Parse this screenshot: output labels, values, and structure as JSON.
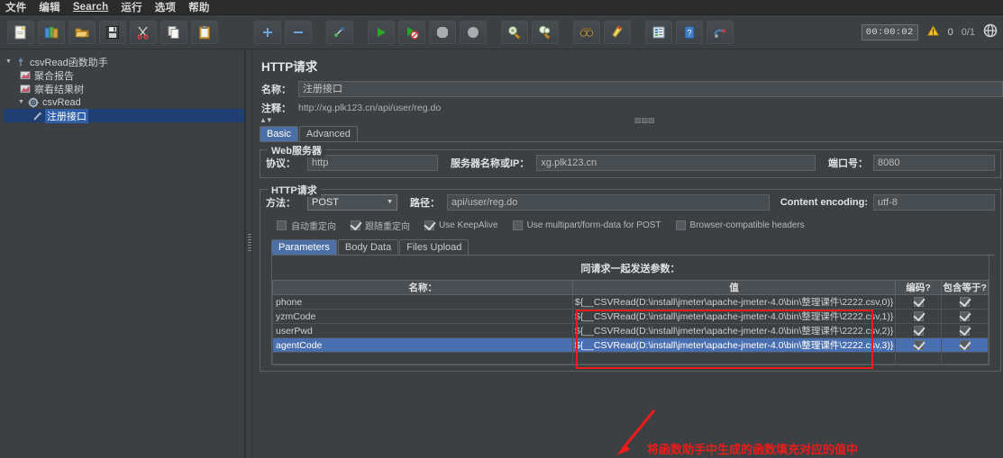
{
  "menu": {
    "items": [
      {
        "label": "文件"
      },
      {
        "label": "编辑"
      },
      {
        "label": "Search",
        "underline_first": true
      },
      {
        "label": "运行"
      },
      {
        "label": "选项"
      },
      {
        "label": "帮助"
      }
    ]
  },
  "toolbar": {
    "left_buttons": [
      {
        "name": "new-icon"
      },
      {
        "name": "templates-icon"
      },
      {
        "name": "open-icon"
      },
      {
        "name": "save-icon"
      },
      {
        "name": "cut-icon"
      },
      {
        "name": "copy-icon"
      },
      {
        "name": "paste-icon"
      }
    ],
    "main_buttons": [
      {
        "name": "expand-all-icon"
      },
      {
        "name": "collapse-all-icon"
      },
      {
        "name": "toggle-icon"
      },
      {
        "name": "start-icon"
      },
      {
        "name": "start-no-pauses-icon"
      },
      {
        "name": "stop-icon"
      },
      {
        "name": "shutdown-icon"
      },
      {
        "name": "clear-icon"
      },
      {
        "name": "clear-all-icon"
      },
      {
        "name": "search-icon"
      },
      {
        "name": "search-reset-icon"
      },
      {
        "name": "function-helper-icon"
      },
      {
        "name": "help-icon"
      },
      {
        "name": "undo-redo-icon"
      }
    ],
    "status": {
      "timer": "00:00:02",
      "warning_count": "0",
      "thread_count": "0/1",
      "warning_icon": "warning-triangle-icon",
      "remote_icon": "globe-icon"
    }
  },
  "tree": {
    "nodes": [
      {
        "label": "csvRead函数助手",
        "icon": "test-plan-icon",
        "depth": 0,
        "expanded": true,
        "selected": false
      },
      {
        "label": "聚合报告",
        "icon": "report-icon",
        "depth": 1,
        "expanded": null,
        "selected": false
      },
      {
        "label": "察看结果树",
        "icon": "report-icon",
        "depth": 1,
        "expanded": null,
        "selected": false
      },
      {
        "label": "csvRead",
        "icon": "thread-group-icon",
        "depth": 1,
        "expanded": true,
        "selected": false
      },
      {
        "label": "注册接口",
        "icon": "http-sampler-icon",
        "depth": 2,
        "expanded": null,
        "selected": true
      }
    ]
  },
  "panel": {
    "title": "HTTP请求",
    "name_label": "名称：",
    "name_value": "注册接口",
    "comment_label": "注释：",
    "comment_value": "http://xg.plk123.cn/api/user/reg.do",
    "tabs": [
      {
        "label": "Basic",
        "active": true
      },
      {
        "label": "Advanced",
        "active": false
      }
    ],
    "webserver": {
      "group_title": "Web服务器",
      "protocol_label": "协议：",
      "protocol_value": "http",
      "server_label": "服务器名称或IP：",
      "server_value": "xg.plk123.cn",
      "port_label": "端口号：",
      "port_value": "8080"
    },
    "httprequest": {
      "group_title": "HTTP请求",
      "method_label": "方法：",
      "method_value": "POST",
      "path_label": "路径：",
      "path_value": "api/user/reg.do",
      "encoding_label": "Content encoding:",
      "encoding_value": "utf-8",
      "checkboxes": [
        {
          "label": "自动重定向",
          "checked": false
        },
        {
          "label": "跟随重定向",
          "checked": true
        },
        {
          "label": "Use KeepAlive",
          "checked": true
        },
        {
          "label": "Use multipart/form-data for POST",
          "checked": false
        },
        {
          "label": "Browser-compatible headers",
          "checked": false
        }
      ]
    },
    "param_tabs": [
      {
        "label": "Parameters",
        "active": true
      },
      {
        "label": "Body Data",
        "active": false
      },
      {
        "label": "Files Upload",
        "active": false
      }
    ],
    "table": {
      "caption": "同请求一起发送参数：",
      "columns": [
        "名称：",
        "值",
        "编码?",
        "包含等于?"
      ],
      "rows": [
        {
          "name": "phone",
          "value": "${__CSVRead(D:\\install\\jmeter\\apache-jmeter-4.0\\bin\\整理课件\\2222.csv,0)}",
          "encode": true,
          "include_equals": true,
          "selected": false
        },
        {
          "name": "yzmCode",
          "value": "${__CSVRead(D:\\install\\jmeter\\apache-jmeter-4.0\\bin\\整理课件\\2222.csv,1)}",
          "encode": true,
          "include_equals": true,
          "selected": false
        },
        {
          "name": "userPwd",
          "value": "${__CSVRead(D:\\install\\jmeter\\apache-jmeter-4.0\\bin\\整理课件\\2222.csv,2)}",
          "encode": true,
          "include_equals": true,
          "selected": false
        },
        {
          "name": "agentCode",
          "value": "${__CSVRead(D:\\install\\jmeter\\apache-jmeter-4.0\\bin\\整理课件\\2222.csv,3)}",
          "encode": true,
          "include_equals": true,
          "selected": true
        }
      ]
    }
  },
  "annotation": {
    "text": "将函数助手中生成的函数填充对应的值中",
    "highlight_color": "#ee1b1b",
    "arrow_name": "red-arrow-annotation"
  }
}
